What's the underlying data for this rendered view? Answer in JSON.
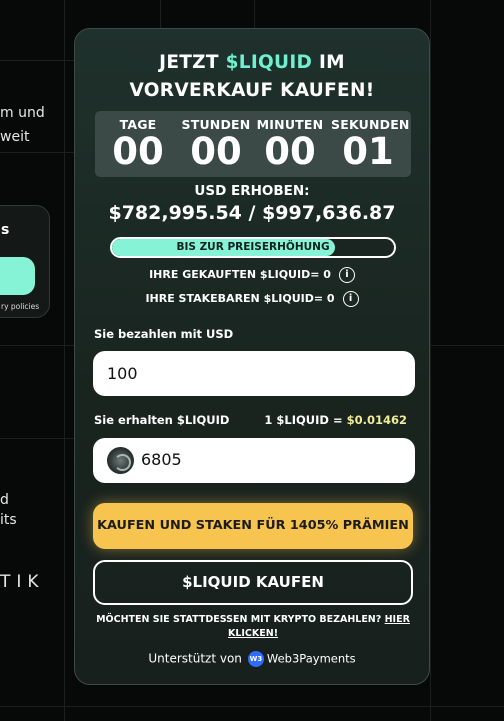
{
  "background": {
    "text_lines": [
      "m und",
      "weit",
      "d",
      "its"
    ],
    "partial_word": "TIK",
    "card": {
      "title": "s",
      "small_text": "ry policies"
    }
  },
  "widget": {
    "headline_pre": "JETZT ",
    "headline_accent": "$LIQUID",
    "headline_post": " IM",
    "headline_line2": "VORVERKAUF KAUFEN!",
    "countdown": [
      {
        "label": "TAGE",
        "value": "00"
      },
      {
        "label": "STUNDEN",
        "value": "00"
      },
      {
        "label": "MINUTEN",
        "value": "00"
      },
      {
        "label": "SEKUNDEN",
        "value": "01"
      }
    ],
    "raised_label": "USD ERHOBEN:",
    "raised_value": "$782,995.54 / $997,636.87",
    "progress": {
      "label": "BIS ZUR PREISERHÖHUNG",
      "fraction": 0.79
    },
    "purchased_label": "IHRE GEKAUFTEN $LIQUID= 0",
    "stakeable_label": "IHRE STAKEBAREN $LIQUID= 0",
    "info_icon": "i",
    "pay_label": "Sie bezahlen mit USD",
    "pay_value": "100",
    "receive_label": "Sie erhalten $LIQUID",
    "price_prefix": "1 $LIQUID = ",
    "price_value": "$0.01462",
    "receive_value": "6805",
    "stake_button": "KAUFEN UND STAKEN FÜR 1405% PRÄMIEN",
    "buy_button": "$LIQUID KAUFEN",
    "crypto_note": "MÖCHTEN SIE STATTDESSEN MIT KRYPTO BEZAHLEN?",
    "crypto_link": "HIER KLICKEN!",
    "powered_by": "Unterstützt von",
    "powered_icon": "W3",
    "powered_brand": "Web3Payments"
  },
  "colors": {
    "accent": "#6ff0d0",
    "progress_fill": "#86f2d6",
    "stake_button": "#f6c44f",
    "price_highlight": "#f1ec9a"
  }
}
